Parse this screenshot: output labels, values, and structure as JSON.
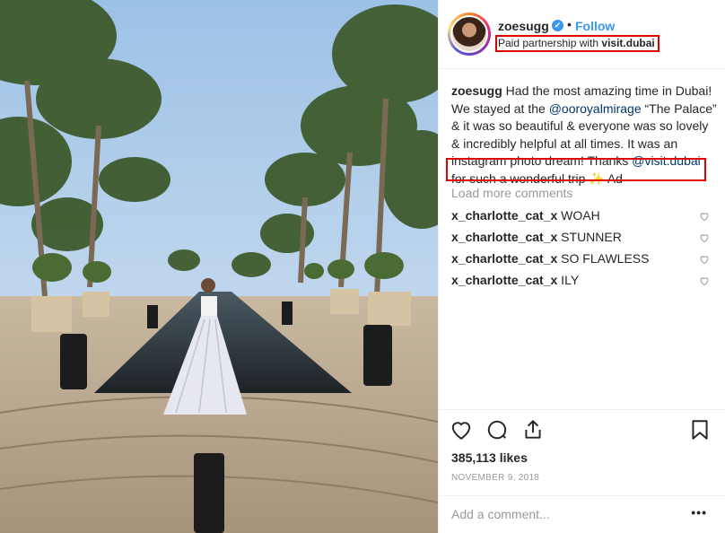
{
  "post": {
    "username": "zoesugg",
    "follow_label": "Follow",
    "dot": "•",
    "verified_glyph": "✔",
    "partner_prefix": "Paid partnership with ",
    "partner_account": "visit.dubai"
  },
  "caption": {
    "username": "zoesugg",
    "text_1": " Had the most amazing time in Dubai! We stayed at the ",
    "mention_1": "@ooroyalmirage",
    "text_2": " “The Palace” & it was so beautiful & everyone was so lovely & incredibly helpful at all times. It was an instagram photo dream! Thanks ",
    "mention_2": "@visit.dubai",
    "text_3": " for such a wonderful trip ✨ Ad"
  },
  "load_more": "Load more comments",
  "comments": [
    {
      "user": "x_charlotte_cat_x",
      "text": " WOAH"
    },
    {
      "user": "x_charlotte_cat_x",
      "text": " STUNNER"
    },
    {
      "user": "x_charlotte_cat_x",
      "text": " SO FLAWLESS"
    },
    {
      "user": "x_charlotte_cat_x",
      "text": " ILY"
    }
  ],
  "likes": "385,113 likes",
  "date": "NOVEMBER 9, 2018",
  "add_comment_placeholder": "Add a comment...",
  "more_options": "•••",
  "colors": {
    "accent": "#3897f0",
    "highlight_box": "#e00000",
    "mention": "#003569",
    "muted": "#999999"
  }
}
